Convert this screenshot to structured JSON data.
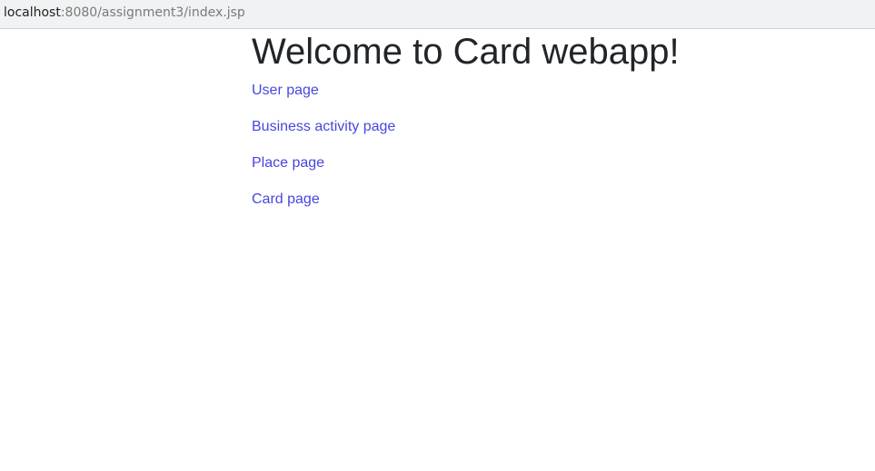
{
  "address_bar": {
    "host": "localhost",
    "path": ":8080/assignment3/index.jsp"
  },
  "page": {
    "heading": "Welcome to Card webapp!",
    "links": [
      {
        "label": "User page"
      },
      {
        "label": "Business activity page"
      },
      {
        "label": "Place page"
      },
      {
        "label": "Card page"
      }
    ]
  },
  "colors": {
    "link": "#4646e0",
    "heading": "#212529",
    "address_bar_background": "#f1f2f3"
  }
}
